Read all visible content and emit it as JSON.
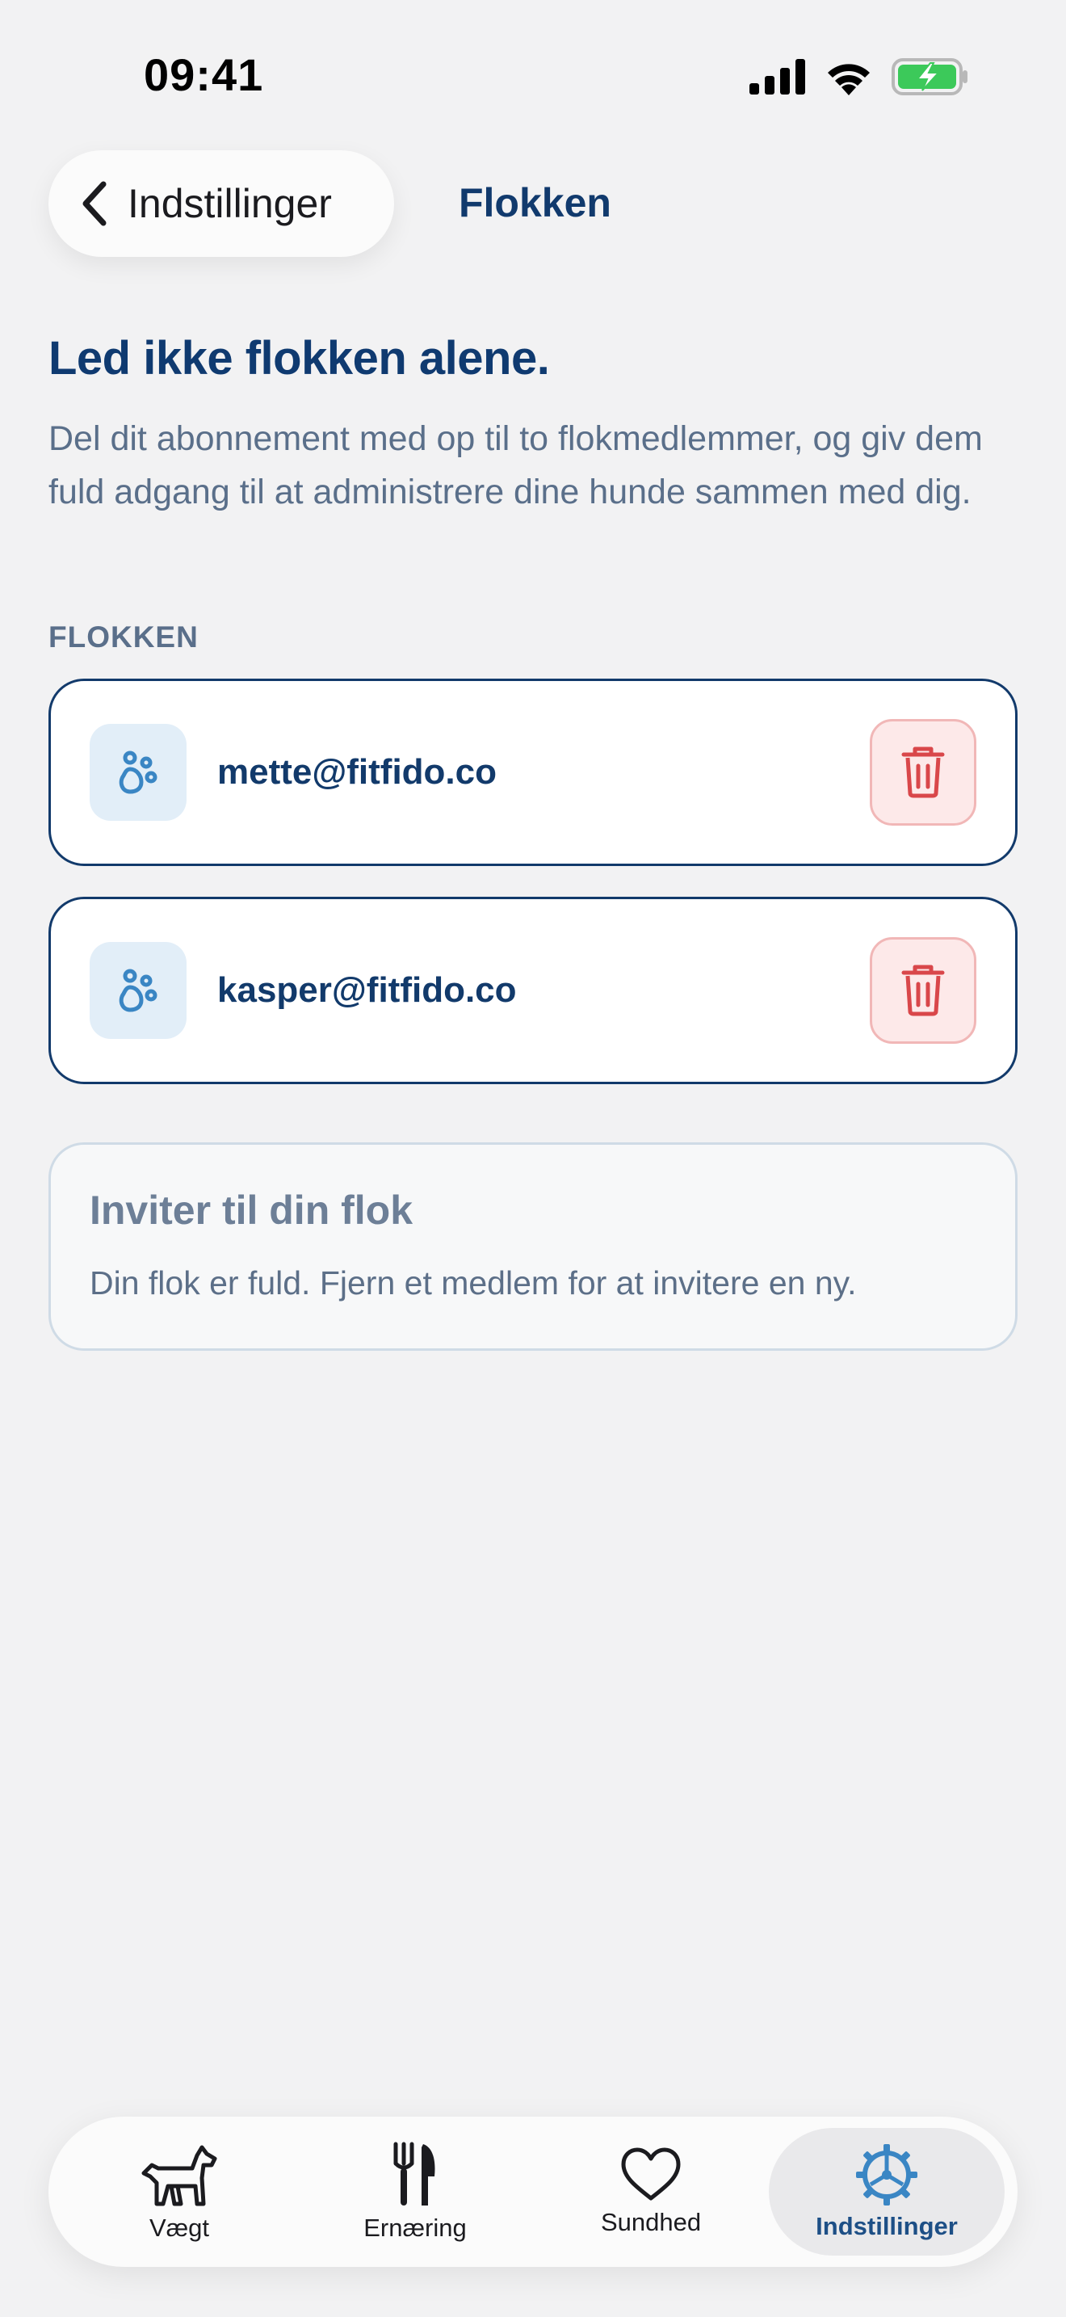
{
  "status_bar": {
    "time": "09:41",
    "icons": [
      "signal-icon",
      "wifi-icon",
      "battery-charging-icon"
    ]
  },
  "header": {
    "back_label": "Indstillinger",
    "title": "Flokken"
  },
  "intro": {
    "headline": "Led ikke flokken alene.",
    "body": "Del dit abonnement med op til to flokmedlemmer, og giv dem fuld adgang til at administrere dine hunde sammen med dig."
  },
  "section": {
    "label": "FLOKKEN"
  },
  "members": [
    {
      "email": "mette@fitfido.co",
      "icon": "paw-icon",
      "action_icon": "trash-icon"
    },
    {
      "email": "kasper@fitfido.co",
      "icon": "paw-icon",
      "action_icon": "trash-icon"
    }
  ],
  "invite": {
    "title": "Inviter til din flok",
    "description": "Din flok er fuld. Fjern et medlem for at invitere en ny."
  },
  "tab_bar": {
    "tabs": [
      {
        "label": "Vægt",
        "icon": "dog-icon",
        "active": false
      },
      {
        "label": "Ernæring",
        "icon": "fork-knife-icon",
        "active": false
      },
      {
        "label": "Sundhed",
        "icon": "heart-icon",
        "active": false
      },
      {
        "label": "Indstillinger",
        "icon": "gear-icon",
        "active": true
      }
    ]
  },
  "colors": {
    "primary": "#123a6b",
    "accent_blue": "#3a86c4",
    "danger": "#d9474a",
    "background": "#f2f2f3"
  }
}
